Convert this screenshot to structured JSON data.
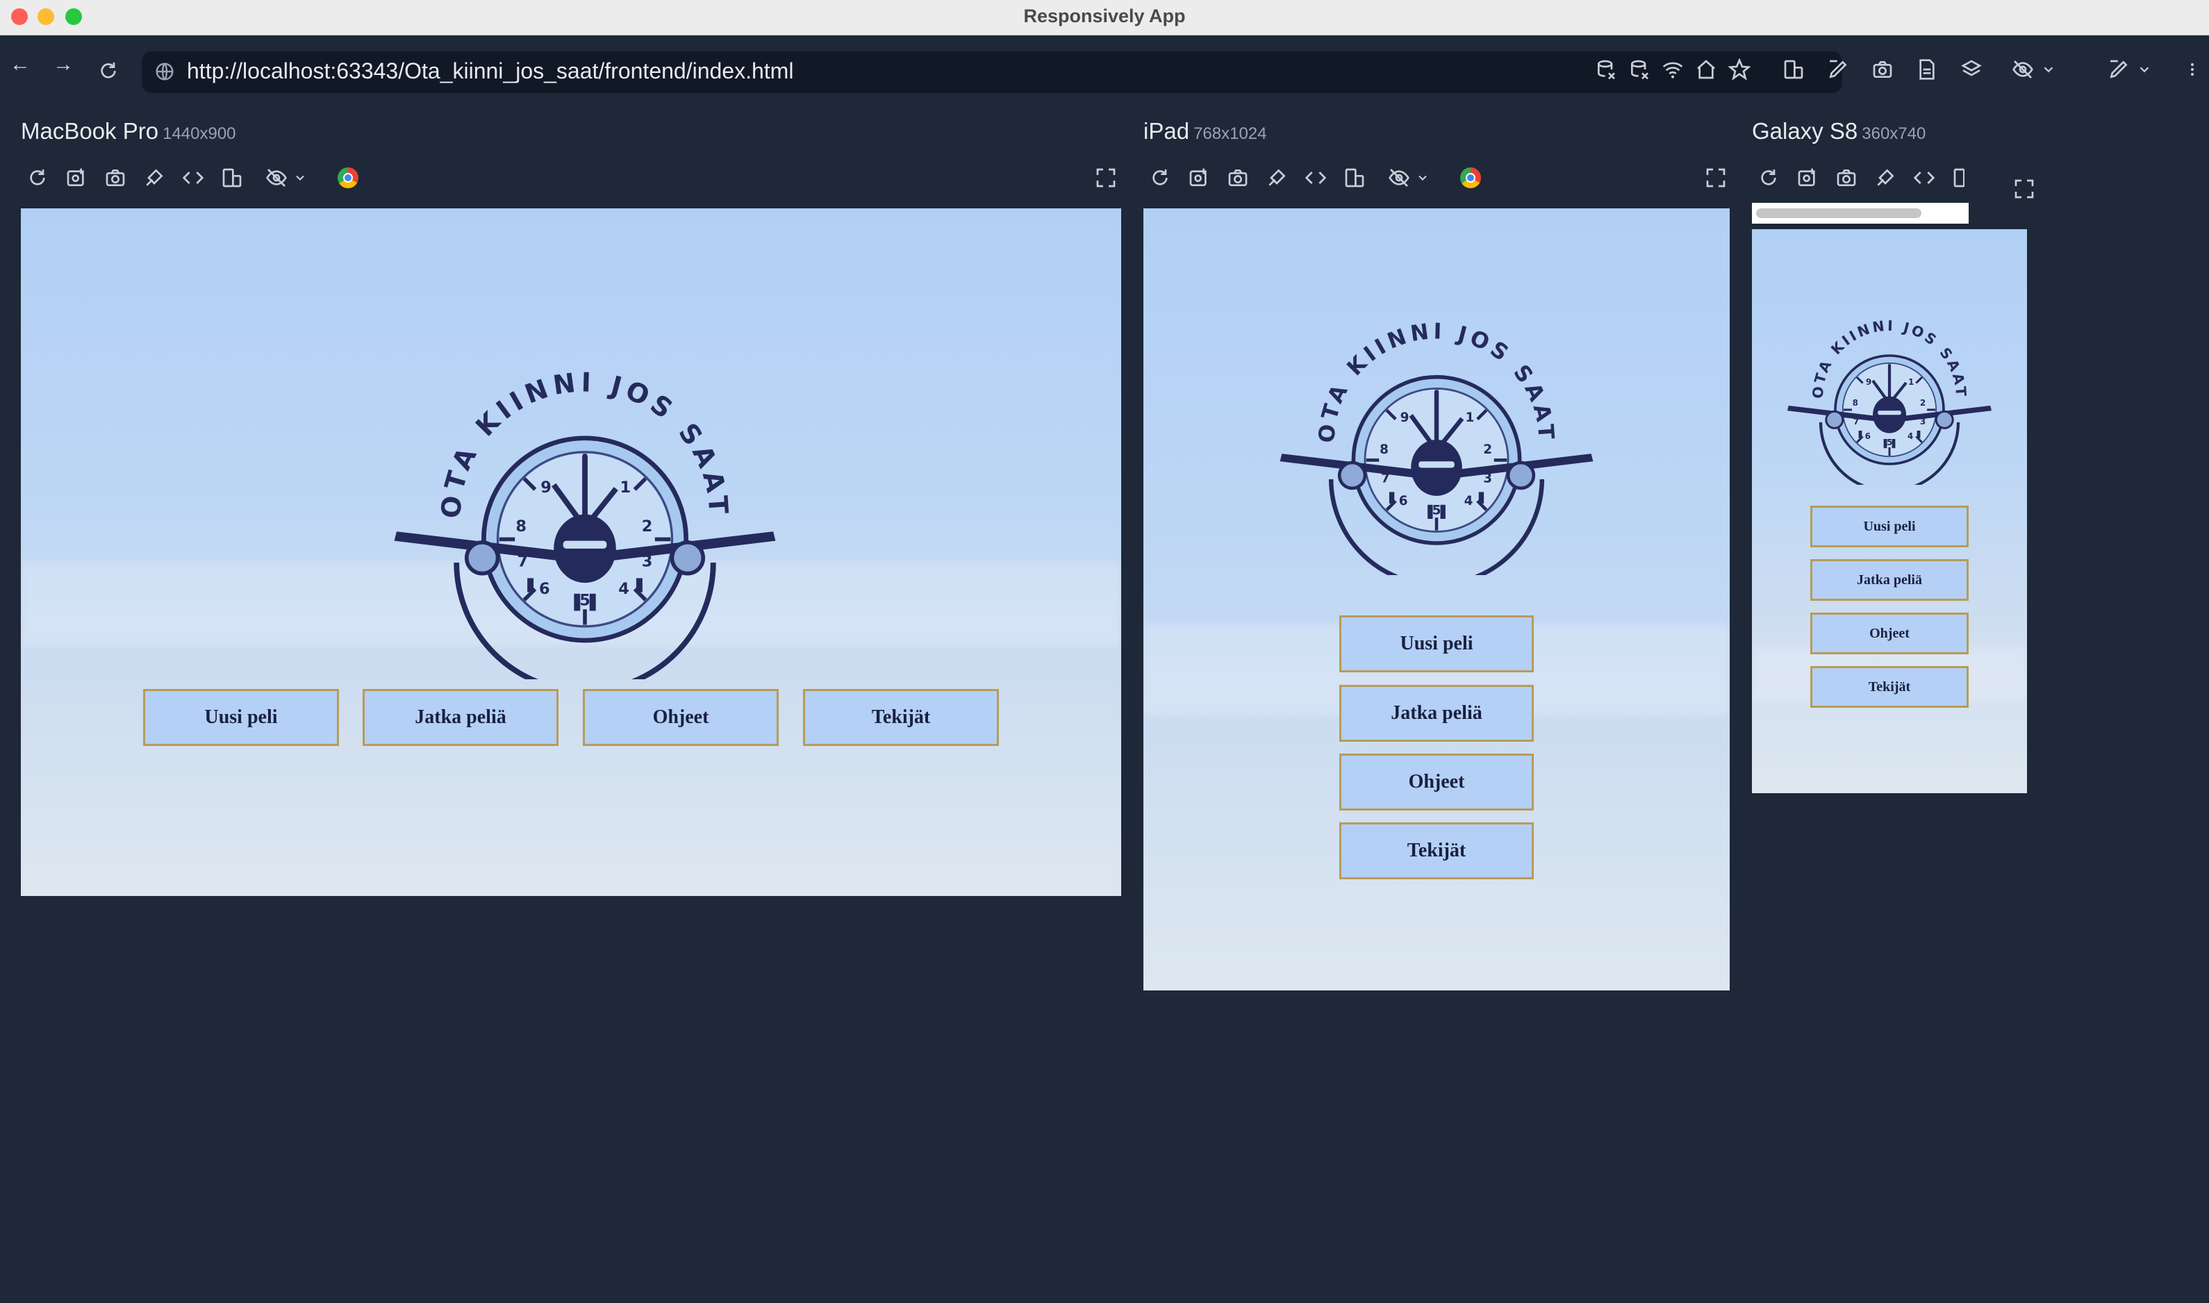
{
  "window": {
    "title": "Responsively App"
  },
  "address_bar": {
    "url": "http://localhost:63343/Ota_kiinni_jos_saat/frontend/index.html"
  },
  "devices": [
    {
      "name": "MacBook Pro",
      "resolution": "1440x900"
    },
    {
      "name": "iPad",
      "resolution": "768x1024"
    },
    {
      "name": "Galaxy S8",
      "resolution": "360x740"
    }
  ],
  "logo_text": {
    "arc": "OTA KIINNI JOS SAAT"
  },
  "menu": {
    "new_game": "Uusi peli",
    "continue_game": "Jatka peliä",
    "instructions": "Ohjeet",
    "credits": "Tekijät"
  },
  "colors": {
    "app_bg": "#1f2838",
    "viewport_sky": "#b2cff5",
    "button_bg": "#b4d0f6",
    "button_border": "#b79c57",
    "logo_navy": "#252a5c"
  },
  "icons": {
    "nav": [
      "back-icon",
      "forward-icon",
      "reload-icon"
    ],
    "device_toolbar": [
      "reload-icon",
      "screenshot-full-icon",
      "camera-icon",
      "inspect-icon",
      "code-icon",
      "rotate-icon",
      "hide-icon",
      "chrome-icon",
      "fullscreen-icon"
    ]
  }
}
